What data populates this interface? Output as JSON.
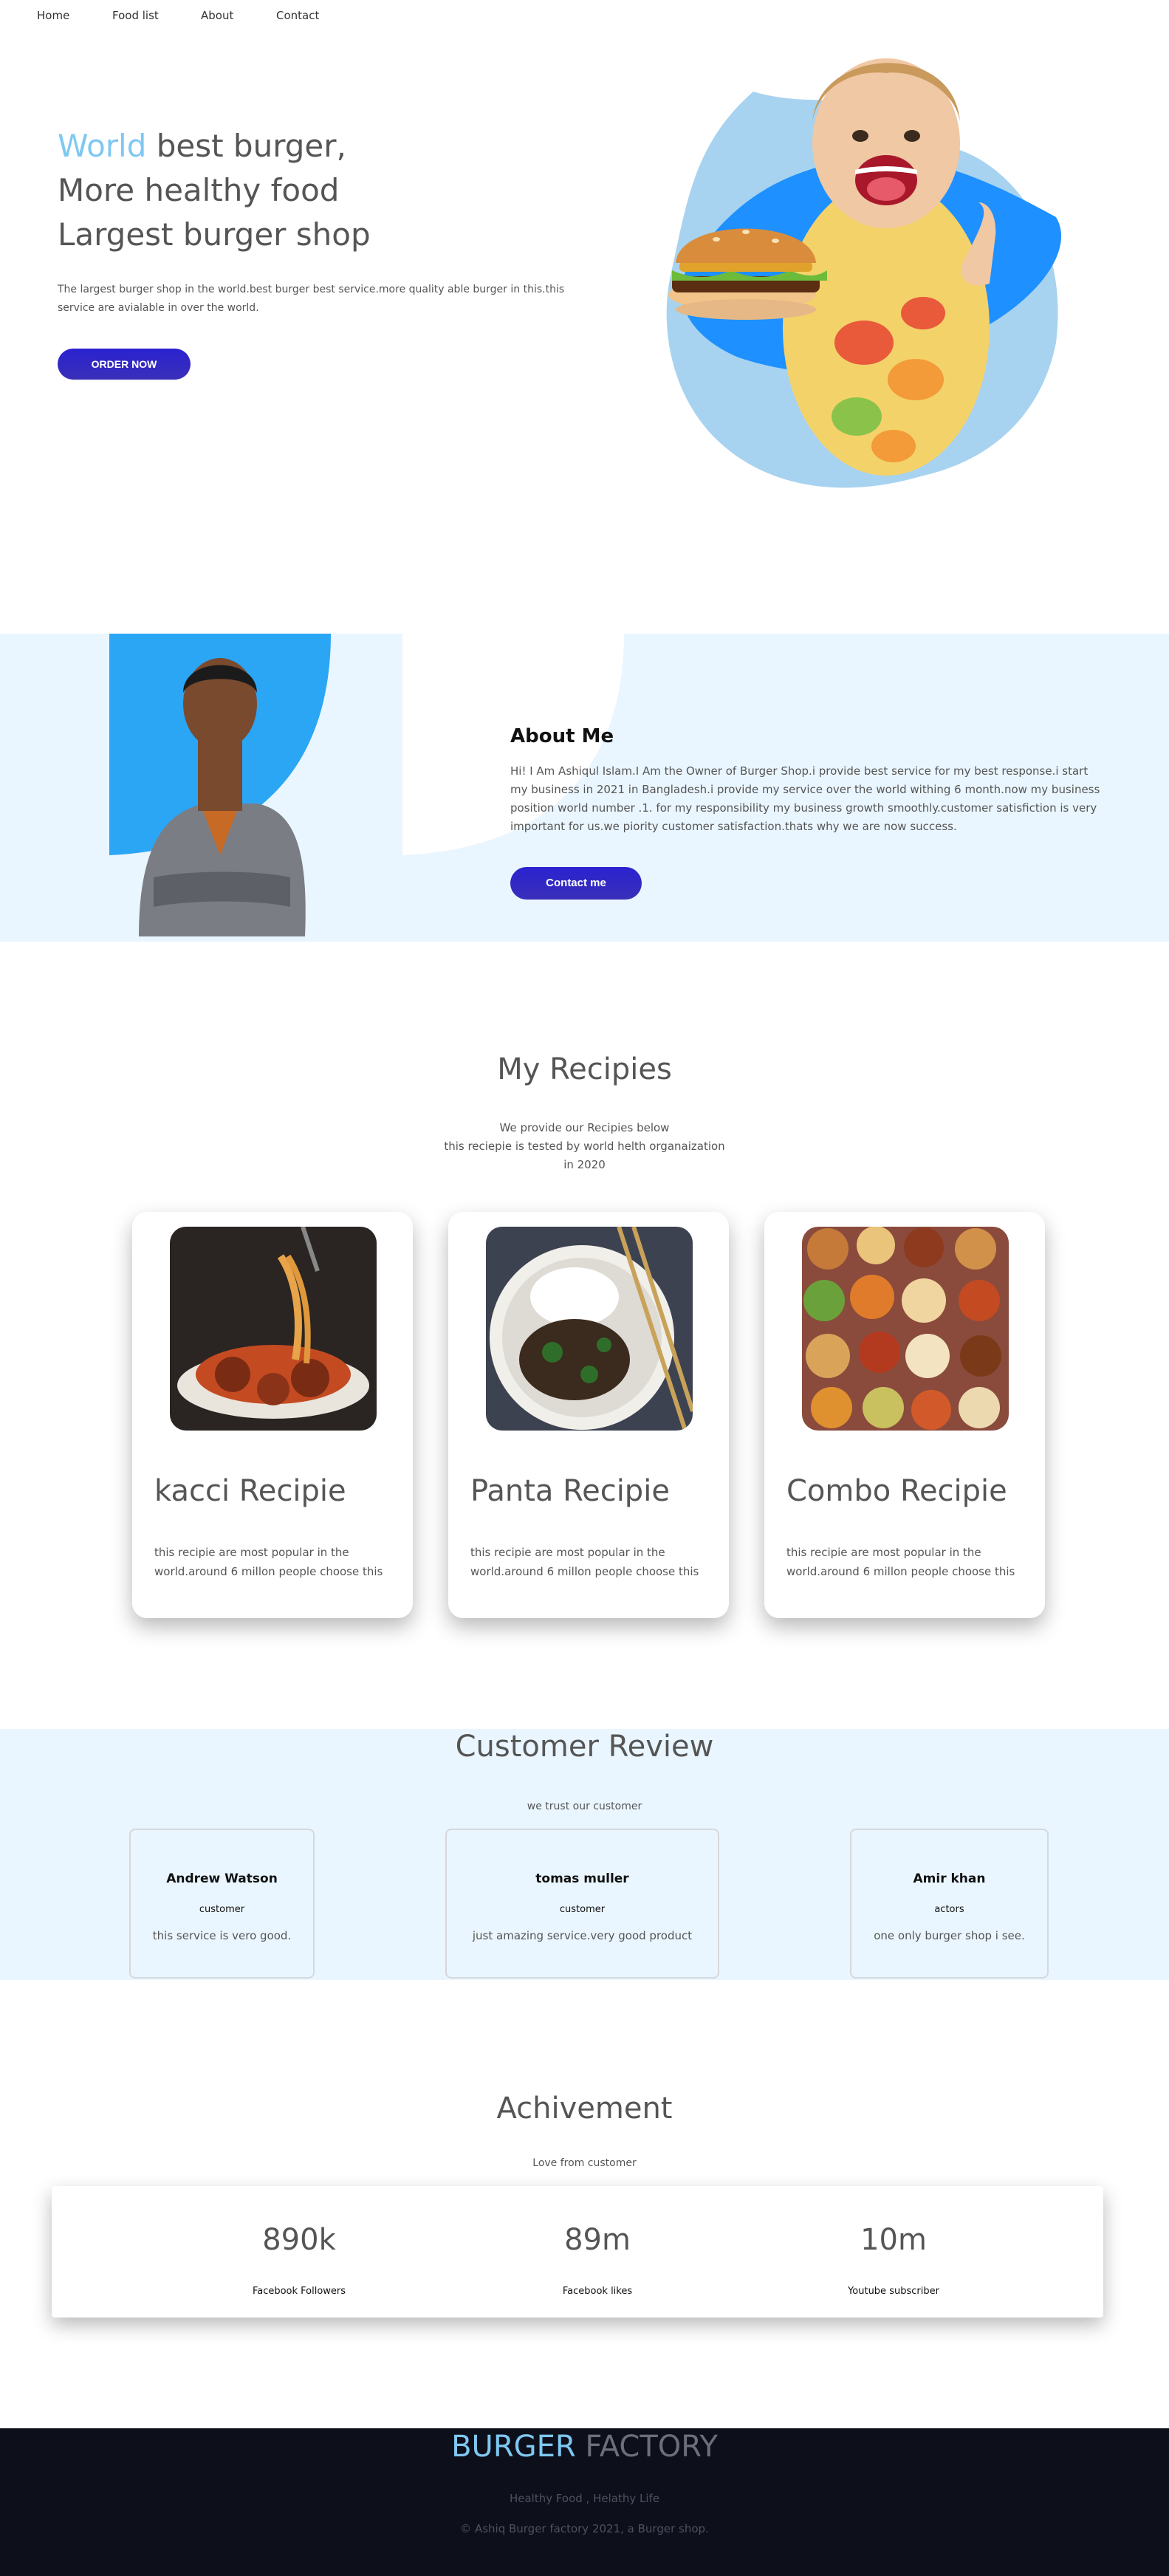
{
  "nav": {
    "items": [
      "Home",
      "Food list",
      "About",
      "Contact"
    ]
  },
  "hero": {
    "title_accent": "World",
    "title_line1_rest": " best burger,",
    "title_line2": "More healthy food",
    "title_line3": "Largest burger shop",
    "description": "The largest burger shop in the world.best burger best service.more quality able burger in this.this service are avialable in over the world.",
    "order_button": "ORDER NOW"
  },
  "about": {
    "title": "About Me",
    "text": "Hi! I Am Ashiqul Islam.I Am the Owner of Burger Shop.i provide best service for my best response.i start my business in 2021 in Bangladesh.i provide my service over the world withing 6 month.now my business position world number .1. for my responsibility my business growth smoothly.customer satisfiction is very important for us.we piority customer satisfaction.thats why we are now success.",
    "contact_button": "Contact me"
  },
  "recipes": {
    "title": "My Recipies",
    "subtitle_lines": [
      "We provide our Recipies below",
      "this reciepie is tested by world helth organaization",
      "in 2020"
    ],
    "cards": [
      {
        "title": "kacci Recipie",
        "text": "this recipie are most popular in the world.around 6 millon people choose this",
        "image": "spaghetti-meatballs"
      },
      {
        "title": "Panta Recipie",
        "text": "this recipie are most popular in the world.around 6 millon people choose this",
        "image": "rice-beef-broccoli"
      },
      {
        "title": "Combo Recipie",
        "text": "this recipie are most popular in the world.around 6 millon people choose this",
        "image": "bowls-assortment"
      }
    ]
  },
  "reviews": {
    "title": "Customer Review",
    "subtitle": "we trust our customer",
    "items": [
      {
        "name": "Andrew Watson",
        "role": "customer",
        "text": "this service is vero good."
      },
      {
        "name": "tomas muller",
        "role": "customer",
        "text": "just amazing service.very good product"
      },
      {
        "name": "Amir khan",
        "role": "actors",
        "text": "one only burger shop i see."
      }
    ]
  },
  "achievement": {
    "title": "Achivement",
    "subtitle": "Love from customer",
    "stats": [
      {
        "value": "890k",
        "label": "Facebook Followers"
      },
      {
        "value": "89m",
        "label": "Facebook likes"
      },
      {
        "value": "10m",
        "label": "Youtube subscriber"
      }
    ]
  },
  "footer": {
    "brand_part1": "BURGER",
    "brand_part2": " FACTORY",
    "tagline": "Healthy Food , Helathy Life",
    "copyright": "© Ashiq Burger factory 2021, a Burger shop."
  },
  "colors": {
    "accent": "#7ec8f2",
    "button": "#2a22d0",
    "band": "#eaf6ff",
    "footer_bg": "#0d0f1a",
    "hero_blue": "#1e90ff"
  }
}
